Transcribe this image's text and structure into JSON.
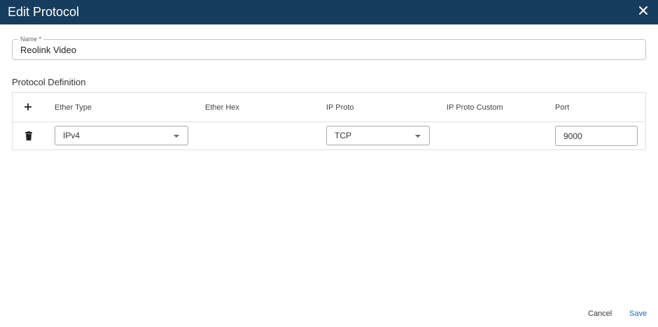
{
  "dialog": {
    "title": "Edit Protocol"
  },
  "name_field": {
    "label": "Name *",
    "value": "Reolink Video"
  },
  "protocol_definition": {
    "section_title": "Protocol Definition",
    "columns": [
      "Ether Type",
      "Ether Hex",
      "IP Proto",
      "IP Proto Custom",
      "Port"
    ],
    "rows": [
      {
        "ether_type": "IPv4",
        "ether_hex": "",
        "ip_proto": "TCP",
        "ip_proto_custom": "",
        "port": "9000"
      }
    ]
  },
  "footer": {
    "cancel_label": "Cancel",
    "save_label": "Save"
  },
  "colors": {
    "titlebar": "#173d5e",
    "save_accent": "#1a66c2"
  },
  "icons": {
    "close": "close-icon",
    "add": "plus-icon",
    "delete": "trash-icon",
    "dropdown": "chevron-down-icon"
  }
}
